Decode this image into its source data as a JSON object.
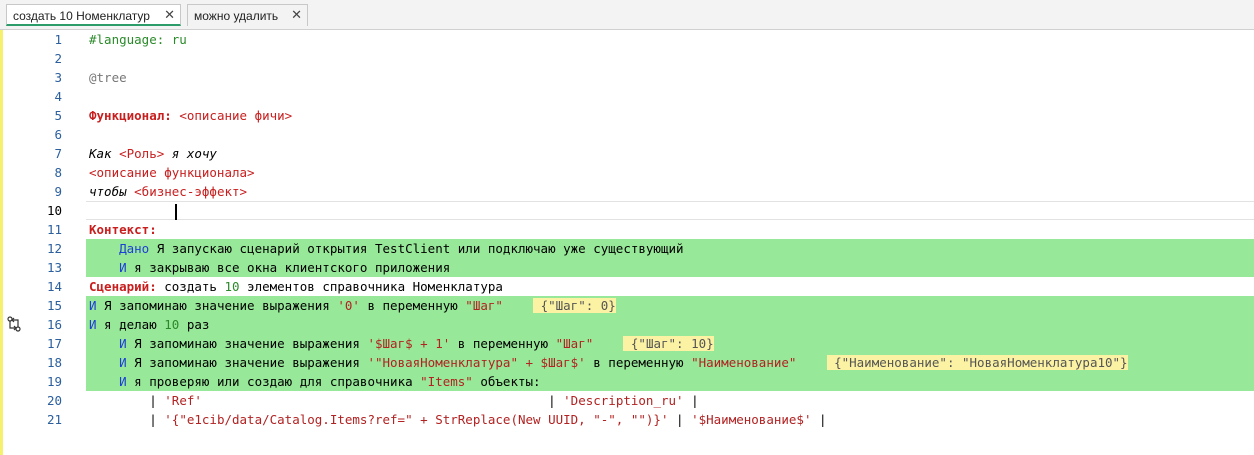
{
  "tabs": [
    {
      "label": "создать 10 Номенклатур",
      "close": "✕",
      "active": true
    },
    {
      "label": "можно удалить",
      "close": "✕",
      "active": false
    }
  ],
  "icons": {
    "branch": "branch-icon",
    "close": "close-icon"
  },
  "colors": {
    "highlight": "#98e899",
    "keyword": "#c81e1e",
    "step": "#1d3fd6",
    "string": "#b22222",
    "value_bg": "#fbf3a3"
  },
  "editor": {
    "current_line": 10,
    "lines": [
      {
        "n": "1",
        "parts": [
          {
            "t": "#language: ru",
            "c": "c-green"
          }
        ]
      },
      {
        "n": "2",
        "parts": []
      },
      {
        "n": "3",
        "parts": [
          {
            "t": "@tree",
            "c": "c-grey"
          }
        ]
      },
      {
        "n": "4",
        "parts": []
      },
      {
        "n": "5",
        "parts": [
          {
            "t": "Функционал:",
            "c": "c-red"
          },
          {
            "t": " <описание фичи>",
            "c": "c-red-plain"
          }
        ]
      },
      {
        "n": "6",
        "parts": []
      },
      {
        "n": "7",
        "parts": [
          {
            "t": "Как ",
            "c": "c-italic"
          },
          {
            "t": "<Роль>",
            "c": "c-red-plain"
          },
          {
            "t": " я хочу",
            "c": "c-italic"
          }
        ]
      },
      {
        "n": "8",
        "parts": [
          {
            "t": "<описание функционала>",
            "c": "c-red-plain"
          }
        ]
      },
      {
        "n": "9",
        "parts": [
          {
            "t": "чтобы ",
            "c": "c-italic"
          },
          {
            "t": "<бизнес-эффект>",
            "c": "c-red-plain"
          }
        ]
      },
      {
        "n": "10",
        "parts": []
      },
      {
        "n": "11",
        "parts": [
          {
            "t": "Контекст:",
            "c": "c-red"
          }
        ]
      },
      {
        "n": "12",
        "hl": true,
        "parts": [
          {
            "t": "    Дано",
            "c": "c-blue"
          },
          {
            "t": " Я запускаю сценарий открытия TestClient или подключаю уже существующий",
            "c": ""
          }
        ]
      },
      {
        "n": "13",
        "hl": true,
        "parts": [
          {
            "t": "    И",
            "c": "c-blue"
          },
          {
            "t": " я закрываю все окна клиентского приложения",
            "c": ""
          }
        ]
      },
      {
        "n": "14",
        "parts": [
          {
            "t": "Сценарий:",
            "c": "c-red"
          },
          {
            "t": " создать ",
            "c": ""
          },
          {
            "t": "10",
            "c": "c-num"
          },
          {
            "t": " элементов справочника Номенклатура",
            "c": ""
          }
        ]
      },
      {
        "n": "15",
        "hl": true,
        "parts": [
          {
            "t": "И",
            "c": "c-blue"
          },
          {
            "t": " Я запоминаю значение выражения ",
            "c": ""
          },
          {
            "t": "'0'",
            "c": "c-str"
          },
          {
            "t": " в переменную ",
            "c": ""
          },
          {
            "t": "\"Шаг\"",
            "c": "c-str"
          },
          {
            "t": "    ",
            "c": ""
          },
          {
            "t": " {\"Шаг\": 0}",
            "c": "c-val"
          }
        ]
      },
      {
        "n": "16",
        "hl": true,
        "icon": true,
        "parts": [
          {
            "t": "И",
            "c": "c-blue"
          },
          {
            "t": " я делаю ",
            "c": ""
          },
          {
            "t": "10",
            "c": "c-num"
          },
          {
            "t": " раз",
            "c": ""
          }
        ]
      },
      {
        "n": "17",
        "hl": true,
        "parts": [
          {
            "t": "    И",
            "c": "c-blue"
          },
          {
            "t": " Я запоминаю значение выражения ",
            "c": ""
          },
          {
            "t": "'$Шаг$ + 1'",
            "c": "c-str"
          },
          {
            "t": " в переменную ",
            "c": ""
          },
          {
            "t": "\"Шаг\"",
            "c": "c-str"
          },
          {
            "t": "    ",
            "c": ""
          },
          {
            "t": " {\"Шаг\": 10}",
            "c": "c-val"
          }
        ]
      },
      {
        "n": "18",
        "hl": true,
        "parts": [
          {
            "t": "    И",
            "c": "c-blue"
          },
          {
            "t": " Я запоминаю значение выражения ",
            "c": ""
          },
          {
            "t": "'\"НоваяНоменклатура\" + $Шаг$'",
            "c": "c-str"
          },
          {
            "t": " в переменную ",
            "c": ""
          },
          {
            "t": "\"Наименование\"",
            "c": "c-str"
          },
          {
            "t": "    ",
            "c": ""
          },
          {
            "t": " {\"Наименование\": \"НоваяНоменклатура10\"}",
            "c": "c-val"
          }
        ]
      },
      {
        "n": "19",
        "hl": true,
        "parts": [
          {
            "t": "    И",
            "c": "c-blue"
          },
          {
            "t": " я проверяю или создаю для справочника ",
            "c": ""
          },
          {
            "t": "\"Items\"",
            "c": "c-str"
          },
          {
            "t": " объекты:",
            "c": ""
          }
        ]
      },
      {
        "n": "20",
        "parts": [
          {
            "t": "        | ",
            "c": ""
          },
          {
            "t": "'Ref'",
            "c": "c-str"
          },
          {
            "t": "                                              | ",
            "c": ""
          },
          {
            "t": "'Description_ru'",
            "c": "c-str"
          },
          {
            "t": " |",
            "c": ""
          }
        ]
      },
      {
        "n": "21",
        "parts": [
          {
            "t": "        | ",
            "c": ""
          },
          {
            "t": "'{\"e1cib/data/Catalog.Items?ref=\" + StrReplace(New UUID, \"-\", \"\")}'",
            "c": "c-str"
          },
          {
            "t": " | ",
            "c": ""
          },
          {
            "t": "'$Наименование$'",
            "c": "c-str"
          },
          {
            "t": " |",
            "c": ""
          }
        ]
      }
    ]
  }
}
